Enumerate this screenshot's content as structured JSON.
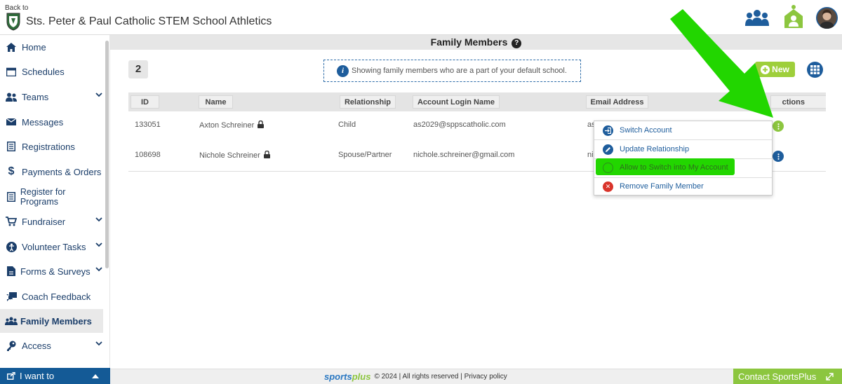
{
  "header": {
    "back_to": "Back to",
    "school_name": "Sts. Peter & Paul Catholic STEM School Athletics"
  },
  "sidebar": {
    "items": [
      {
        "label": "Home",
        "icon": "home-icon"
      },
      {
        "label": "Schedules",
        "icon": "calendar-icon"
      },
      {
        "label": "Teams",
        "icon": "users-icon"
      },
      {
        "label": "Messages",
        "icon": "envelope-icon"
      },
      {
        "label": "Registrations",
        "icon": "form-icon"
      },
      {
        "label": "Payments & Orders",
        "icon": "dollar-icon"
      },
      {
        "label": "Register for Programs",
        "icon": "clipboard-icon"
      },
      {
        "label": "Fundraiser",
        "icon": "cart-icon"
      },
      {
        "label": "Volunteer Tasks",
        "icon": "volunteer-icon"
      },
      {
        "label": "Forms & Surveys",
        "icon": "document-icon"
      },
      {
        "label": "Coach Feedback",
        "icon": "comment-icon"
      },
      {
        "label": "Family Members",
        "icon": "family-icon"
      },
      {
        "label": "Access",
        "icon": "key-icon"
      }
    ],
    "i_want_to": "I want to"
  },
  "page": {
    "title": "Family Members",
    "count": "2",
    "info_text": "Showing family members who are a part of your default school.",
    "new_button": "New"
  },
  "table": {
    "columns": [
      "ID",
      "Name",
      "Relationship",
      "Account Login Name",
      "Email Address",
      "Actions"
    ],
    "actions_visible": "ctions",
    "rows": [
      {
        "id": "133051",
        "name": "Axton Schreiner",
        "relationship": "Child",
        "login": "as2029@sppscatholic.com",
        "email": "as"
      },
      {
        "id": "108698",
        "name": "Nichole Schreiner",
        "relationship": "Spouse/Partner",
        "login": "nichole.schreiner@gmail.com",
        "email": "ni"
      }
    ]
  },
  "menu": {
    "items": [
      "Switch Account",
      "Update Relationship",
      "Allow to Switch into My Account",
      "Remove Family Member"
    ]
  },
  "footer": {
    "brand_a": "sports",
    "brand_b": "plus",
    "copyright": "© 2024 | All rights reserved | Privacy policy",
    "contact": "Contact SportsPlus"
  },
  "colors": {
    "navy": "#1b3e6a",
    "blue": "#1e5d9c",
    "green": "#8cc63f",
    "highlight_green": "#22d600",
    "red": "#d9342b"
  }
}
